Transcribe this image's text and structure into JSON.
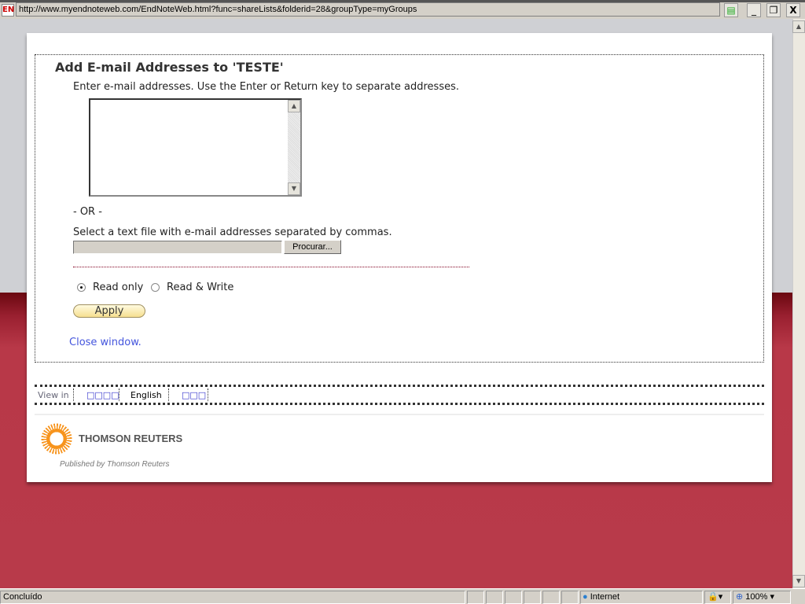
{
  "browser": {
    "url": "http://www.myendnoteweb.com/EndNoteWeb.html?func=shareLists&folderid=28&groupType=myGroups",
    "favicon": "EN",
    "minimize": "_",
    "restore": "❐",
    "close": "X"
  },
  "dialog": {
    "title": "Add E-mail Addresses to 'TESTE'",
    "instructions": "Enter e-mail addresses. Use the Enter or Return key to separate addresses.",
    "emails_value": "",
    "or_label": "- OR -",
    "file_label": "Select a text file with e-mail addresses separated by commas.",
    "file_value": "",
    "browse_label": "Procurar...",
    "permissions": [
      {
        "label": "Read only",
        "selected": true
      },
      {
        "label": "Read & Write",
        "selected": false
      }
    ],
    "apply_label": "Apply",
    "close_link": "Close window."
  },
  "language_bar": {
    "label": "View in",
    "languages": [
      "□□□□",
      "English",
      "□□□"
    ],
    "current": "English"
  },
  "footer": {
    "brand": "THOMSON REUTERS",
    "published": "Published by Thomson Reuters",
    "brand_color": "#f7941d"
  },
  "statusbar": {
    "status": "Concluído",
    "zone": "Internet",
    "zoom": "100%"
  }
}
